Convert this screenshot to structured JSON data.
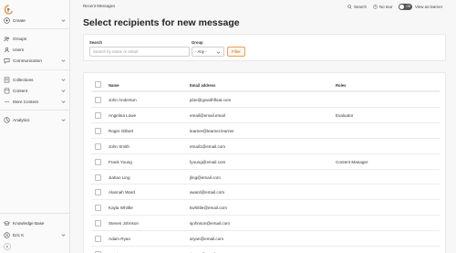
{
  "topbar": {
    "breadcrumb": "Recent Messages",
    "search_label": "Search",
    "tour_label": "No tour",
    "toggle_text": "Off",
    "view_as_learner": "View as learner"
  },
  "sidebar": {
    "create": "Create",
    "groups": "Groups",
    "users": "Users",
    "communication": "Communication",
    "collections": "Collections",
    "content": "Content",
    "more_content": "More Content",
    "analytics": "Analytics",
    "knowledge_base": "Knowledge Base",
    "user_name": "Eric K"
  },
  "page": {
    "title": "Select recipients for new message"
  },
  "filters": {
    "search_label": "Search",
    "search_placeholder": "Search by name or email",
    "group_label": "Group",
    "group_selected": "- Any -",
    "filter_button": "Filter"
  },
  "table": {
    "headers": {
      "name": "Name",
      "email": "Email address",
      "roles": "Roles"
    },
    "rows": [
      {
        "name": "John Anderson",
        "email": "jdoe@gowithfloat.com",
        "role": ""
      },
      {
        "name": "Angelina Lowe",
        "email": "email@email.email",
        "role": "Evaluator"
      },
      {
        "name": "Roger Gilbert",
        "email": "learner@learner.learner",
        "role": ""
      },
      {
        "name": "John Smith",
        "email": "email1@email.com",
        "role": ""
      },
      {
        "name": "Frank Young",
        "email": "fyoung@email.com",
        "role": "Content Manager"
      },
      {
        "name": "Jiahao Ling",
        "email": "jling@email.com",
        "role": ""
      },
      {
        "name": "Alannah Ward",
        "email": "award@email.com",
        "role": ""
      },
      {
        "name": "Kayla Whittle",
        "email": "kwhittle@email.com",
        "role": ""
      },
      {
        "name": "Steven Johnson",
        "email": "sjohnson@email.com",
        "role": ""
      },
      {
        "name": "Adam Ryan",
        "email": "aryan@email.com",
        "role": ""
      },
      {
        "name": "Travis Henry",
        "email": "thenry@email.com",
        "role": ""
      }
    ]
  },
  "colors": {
    "accent": "#e3a15a",
    "logo": "#e38a2f"
  }
}
